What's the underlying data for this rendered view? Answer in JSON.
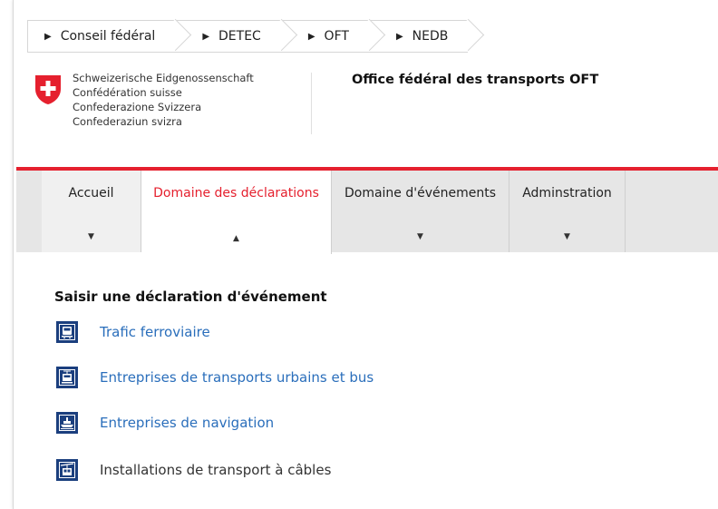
{
  "breadcrumb": [
    {
      "label": "Conseil fédéral"
    },
    {
      "label": "DETEC"
    },
    {
      "label": "OFT"
    },
    {
      "label": "NEDB"
    }
  ],
  "header": {
    "confederation_names": [
      "Schweizerische Eidgenossenschaft",
      "Confédération suisse",
      "Confederazione Svizzera",
      "Confederaziun svizra"
    ],
    "office": "Office fédéral des transports OFT"
  },
  "nav": {
    "items": [
      {
        "label": "Accueil",
        "arrow": "▼"
      },
      {
        "label": "Domaine des déclarations",
        "arrow": "▲"
      },
      {
        "label": "Domaine d'événements",
        "arrow": "▼"
      },
      {
        "label": "Adminstration",
        "arrow": "▼"
      }
    ]
  },
  "main": {
    "title": "Saisir une déclaration d'événement",
    "links": [
      {
        "label": "Trafic ferroviaire",
        "icon": "train-icon"
      },
      {
        "label": "Entreprises de transports urbains et bus",
        "icon": "tram-icon"
      },
      {
        "label": "Entreprises de navigation",
        "icon": "ship-icon"
      },
      {
        "label": "Installations de transport à câbles",
        "icon": "cable-car-icon"
      }
    ]
  },
  "colors": {
    "accent_red": "#e5202e",
    "link_blue": "#2a6ebb",
    "icon_navy": "#1b3f7e"
  }
}
